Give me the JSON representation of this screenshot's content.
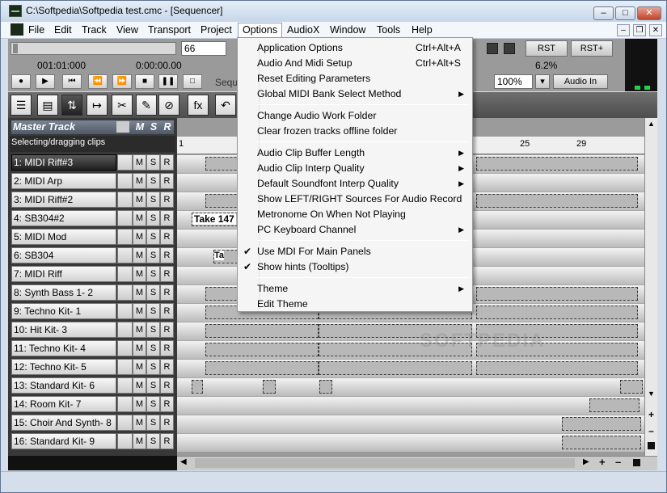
{
  "window": {
    "title": "C:\\Softpedia\\Softpedia test.cmc - [Sequencer]"
  },
  "menubar": [
    "File",
    "Edit",
    "Track",
    "View",
    "Transport",
    "Project",
    "Options",
    "AudioX",
    "Window",
    "Tools",
    "Help"
  ],
  "toolbar": {
    "bar_value": "66",
    "position_bars": "001:01:000",
    "position_time": "0:00:00.00",
    "rst": "RST",
    "rst_plus": "RST+",
    "percent": "6.2%",
    "zoom": "100%",
    "audio_in": "Audio In",
    "seq_label": "Sequ"
  },
  "tracks_panel": {
    "master_label": "Master Track",
    "m": "M",
    "s": "S",
    "r": "R",
    "status": "Selecting/dragging clips",
    "tracks": [
      "1: MIDI Riff#3",
      "2: MIDI Arp",
      "3: MIDI Riff#2",
      "4: SB304#2",
      "5: MIDI Mod",
      "6: SB304",
      "7: MIDI Riff",
      "8: Synth Bass 1- 2",
      "9: Techno Kit- 1",
      "10: Hit Kit- 3",
      "11: Techno Kit- 4",
      "12: Techno Kit- 5",
      "13: Standard Kit- 6",
      "14: Room Kit- 7",
      "15: Choir And Synth- 8",
      "16: Standard Kit- 9"
    ]
  },
  "ruler": [
    "1",
    "25",
    "29"
  ],
  "clips": {
    "take": "Take 147",
    "take_small": "Ta"
  },
  "watermark": "SOFTPEDIA",
  "options_menu": [
    {
      "label": "Application Options",
      "shortcut": "Ctrl+Alt+A"
    },
    {
      "label": "Audio And Midi Setup",
      "shortcut": "Ctrl+Alt+S"
    },
    {
      "label": "Reset Editing Parameters"
    },
    {
      "label": "Global MIDI Bank Select Method",
      "submenu": true
    },
    {
      "label": "Change Audio Work Folder"
    },
    {
      "label": "Clear frozen tracks offline folder"
    },
    {
      "label": "Audio Clip Buffer Length",
      "submenu": true
    },
    {
      "label": "Audio Clip Interp Quality",
      "submenu": true
    },
    {
      "label": "Default Soundfont Interp Quality",
      "submenu": true
    },
    {
      "label": "Show LEFT/RIGHT Sources For Audio Record"
    },
    {
      "label": "Metronome On When Not Playing"
    },
    {
      "label": "PC Keyboard Channel",
      "submenu": true
    },
    {
      "label": "Use MDI For Main Panels",
      "checked": true
    },
    {
      "label": "Show hints (Tooltips)",
      "checked": true
    },
    {
      "label": "Theme",
      "submenu": true
    },
    {
      "label": "Edit Theme"
    }
  ]
}
